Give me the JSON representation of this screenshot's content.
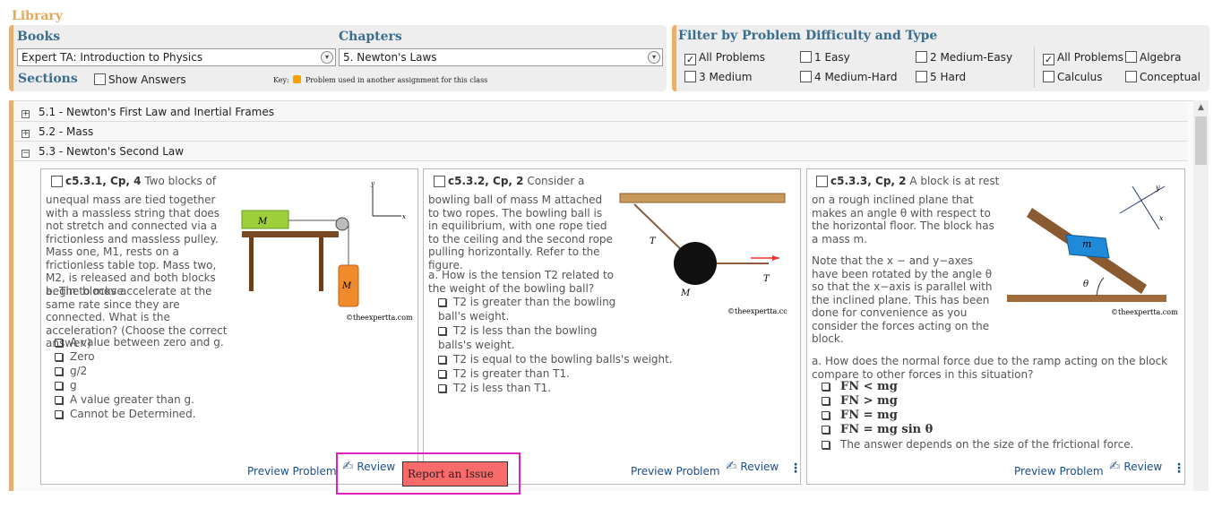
{
  "library_title": "Library",
  "books": {
    "heading": "Books",
    "selected": "Expert TA:  Introduction to Physics"
  },
  "chapters": {
    "heading": "Chapters",
    "selected": "5. Newton's Laws"
  },
  "sections": {
    "heading": "Sections",
    "show_answers_label": "Show Answers"
  },
  "key": {
    "label": "Key:",
    "text": "Problem used in another assignment for this class",
    "color": "#f5a100"
  },
  "filter": {
    "heading": "Filter by Problem Difficulty and Type",
    "difficulty": [
      {
        "label": "All Problems",
        "checked": true
      },
      {
        "label": "1 Easy",
        "checked": false
      },
      {
        "label": "2 Medium-Easy",
        "checked": false
      },
      {
        "label": "3 Medium",
        "checked": false
      },
      {
        "label": "4 Medium-Hard",
        "checked": false
      },
      {
        "label": "5 Hard",
        "checked": false
      }
    ],
    "type": [
      {
        "label": "All Problems",
        "checked": true
      },
      {
        "label": "Algebra",
        "checked": false
      },
      {
        "label": "Calculus",
        "checked": false
      },
      {
        "label": "Conceptual",
        "checked": false
      }
    ]
  },
  "sections_list": [
    {
      "toggle": "+",
      "label": "5.1 - Newton's First Law and Inertial Frames"
    },
    {
      "toggle": "+",
      "label": "5.2 - Mass"
    },
    {
      "toggle": "−",
      "label": "5.3 - Newton's Second Law"
    }
  ],
  "problems": [
    {
      "id": "c5.3.1, Cp, 4",
      "intro": "Two blocks of",
      "body": "unequal mass are tied together with a massless string that does not stretch and connected via a frictionless and massless pulley. Mass one, M1, rests on a frictionless table top. Mass two, M2, is released and both blocks begin to move.",
      "question": "a. The blocks accelerate at the same rate since they are connected. What is the acceleration? (Choose the correct answer.)",
      "options": [
        "A value between zero and g.",
        "Zero",
        "g/2",
        "g",
        "A value greater than g.",
        "Cannot be Determined."
      ],
      "copyright": "©theexpertta.com",
      "preview": "Preview Problem",
      "review": "Review"
    },
    {
      "id": "c5.3.2, Cp, 2",
      "intro": "Consider a",
      "body": "bowling ball of mass M attached to two ropes. The bowling ball is in equilibrium, with one rope tied to the ceiling and the second rope pulling horizontally. Refer to the figure.",
      "question": "a. How is the tension T2 related to the weight of the bowling ball?",
      "options": [
        "T2 is greater than the bowling ball's weight.",
        "T2 is less than the bowling balls's weight.",
        "T2 is equal to the bowling balls's weight.",
        "T2 is greater than  T1.",
        "T2 is less than  T1."
      ],
      "copyright": "©theexpertta.com",
      "preview": "Preview Problem",
      "review": "Review"
    },
    {
      "id": "c5.3.3, Cp, 2",
      "intro": "A block is at rest",
      "body": "on a rough inclined plane that makes an angle θ with respect to the horizontal floor. The block has a mass m.",
      "note": "Note that the x − and y−axes have been rotated by the angle θ so that the x−axis is parallel with the inclined plane. This has been done for convenience as you consider the forces acting on the block.",
      "question": "a. How does the normal force due to the ramp acting on the block compare to other forces in this situation?",
      "options": [
        "FN < mg",
        "FN > mg",
        "FN = mg",
        "FN = mg sin θ",
        "The answer depends on the size of the frictional force."
      ],
      "copyright": "©theexpertta.com",
      "preview": "Preview Problem",
      "review": "Review"
    }
  ],
  "tooltip": {
    "label": "Report an Issue",
    "bg": "#f86b6b",
    "highlight": "#e020c0"
  }
}
